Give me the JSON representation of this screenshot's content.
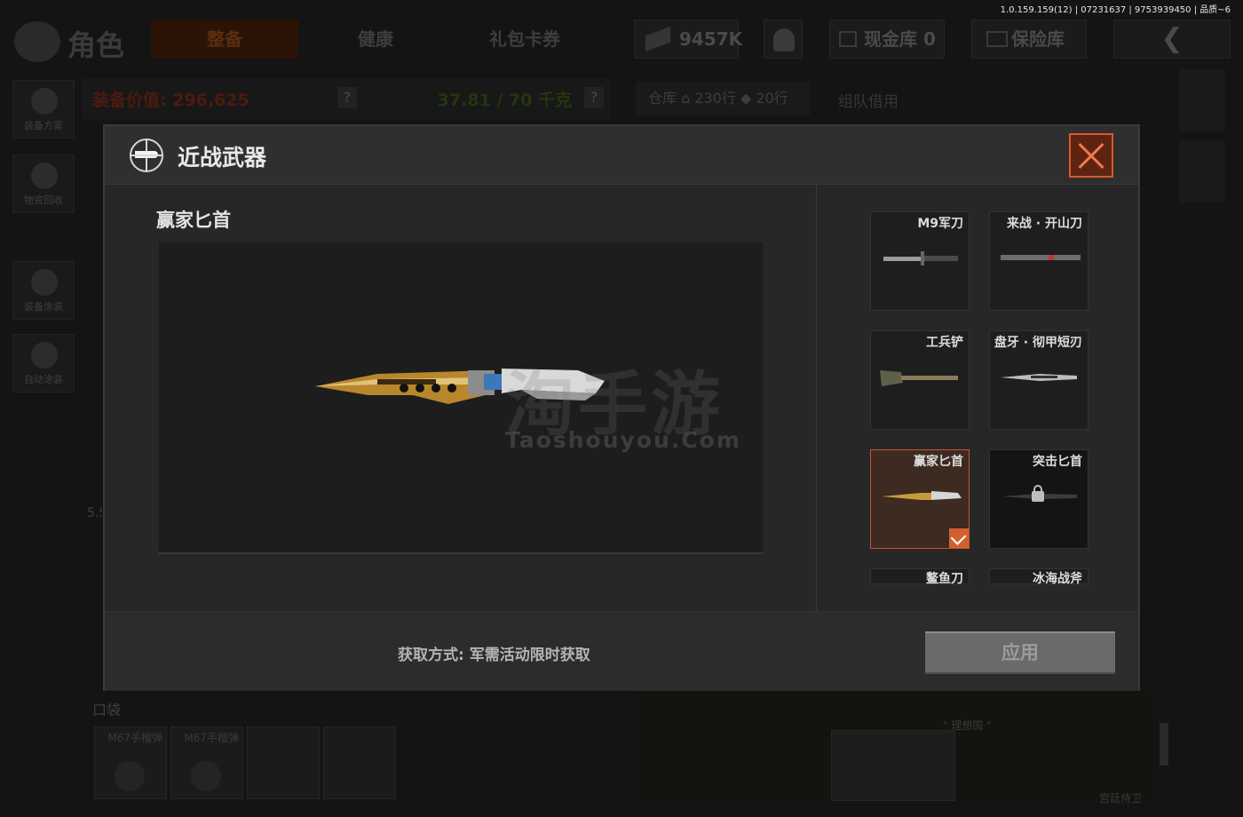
{
  "version_info": "1.0.159.159(12) | 07231637 | 9753939450 | 品质~6",
  "header": {
    "page_title": "角色",
    "tabs": [
      {
        "label": "整备",
        "active": true
      },
      {
        "label": "健康",
        "active": false
      },
      {
        "label": "礼包卡券",
        "active": false
      }
    ],
    "money": "9457K",
    "cash_vault": "现金库 0",
    "insurance": "保险库",
    "back_glyph": "❮"
  },
  "sidebar": {
    "items": [
      {
        "label": "装备方案",
        "icon": "helmet-icon"
      },
      {
        "label": "物资回收",
        "icon": "recycle-icon"
      },
      {
        "label": "装备涂装",
        "icon": "paint-helmet-icon"
      },
      {
        "label": "自动涂装",
        "icon": "spray-gear-icon"
      }
    ]
  },
  "equipment": {
    "value_label": "装备价值: 296,625",
    "weight": "37.81 / 70 千克",
    "help": "?"
  },
  "storage": {
    "label": "仓库",
    "rows_home": "230行",
    "rows_extra": "20行",
    "team_borrow": "组队借用"
  },
  "pocket": {
    "label": "口袋",
    "slots": [
      "M67手榴弹",
      "M67手榴弹"
    ]
  },
  "background_misc": {
    "side_value": "5.5",
    "dream_label": "\" 理想国 \"",
    "bottom_right": "宫廷侍卫"
  },
  "modal": {
    "title": "近战武器",
    "icon": "globe-knife-icon",
    "selected_item_name": "赢家匕首",
    "watermark": "淘手游",
    "watermark_url": "Taoshouyou.Com",
    "items": [
      {
        "name": "M9军刀",
        "selected": false,
        "locked": false
      },
      {
        "name": "来战 · 开山刀",
        "selected": false,
        "locked": false
      },
      {
        "name": "工兵铲",
        "selected": false,
        "locked": false
      },
      {
        "name": "盘牙 · 彻甲短刃",
        "selected": false,
        "locked": false
      },
      {
        "name": "赢家匕首",
        "selected": true,
        "locked": false
      },
      {
        "name": "突击匕首",
        "selected": false,
        "locked": true
      },
      {
        "name": "鳌鱼刀",
        "selected": false,
        "locked": false
      },
      {
        "name": "冰海战斧",
        "selected": false,
        "locked": false
      }
    ],
    "acquire_method": "获取方式: 军需活动限时获取",
    "apply_label": "应用"
  },
  "colors": {
    "accent_orange": "#d2602e",
    "modal_bg": "#272727",
    "apply_disabled": "#6a6a6a"
  }
}
